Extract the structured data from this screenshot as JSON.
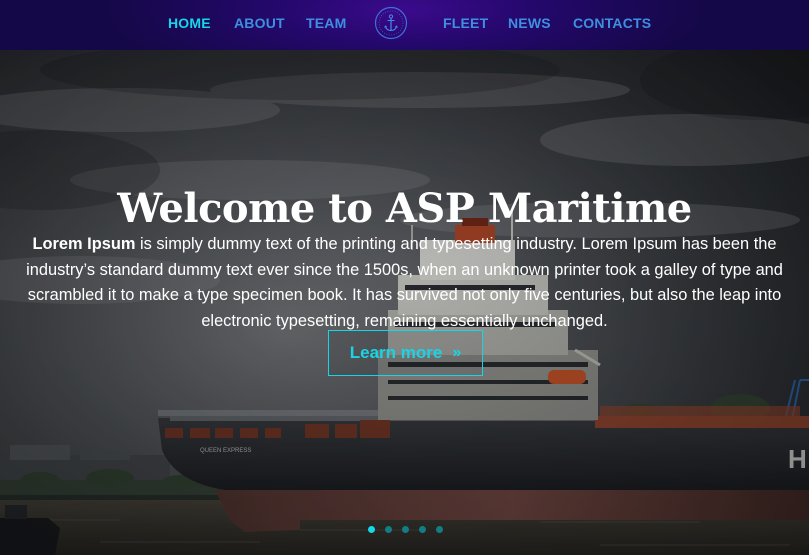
{
  "nav": {
    "items": [
      {
        "label": "HOME",
        "active": true
      },
      {
        "label": "ABOUT",
        "active": false
      },
      {
        "label": "TEAM",
        "active": false
      },
      {
        "label": "FLEET",
        "active": false
      },
      {
        "label": "NEWS",
        "active": false
      },
      {
        "label": "CONTACTS",
        "active": false
      }
    ],
    "logo_icon": "anchor-emblem-icon"
  },
  "hero": {
    "title": "Welcome to ASP Maritime",
    "text_bold": "Lorem Ipsum",
    "text_rest": " is simply dummy text of the printing and typesetting industry. Lorem Ipsum has been the industry’s standard dummy text ever since the 1500s, when an unknown printer took a galley of type and scrambled it to make a type specimen book. It has survived not only five centuries, but also the leap into electronic typesetting, remaining essentially unchanged.",
    "button_label": "Learn more",
    "button_icon": "double-chevron-right-icon",
    "background_image": "container-ship-harbor-photo",
    "ship_name": "QUEEN EXPRESS",
    "hull_letter": "H"
  },
  "slider": {
    "dot_count": 5,
    "active_index": 0
  },
  "colors": {
    "accent": "#16d6e8",
    "nav_link": "#3f8fe0",
    "nav_bg": "#23086a",
    "hero_text": "#ffffff"
  }
}
